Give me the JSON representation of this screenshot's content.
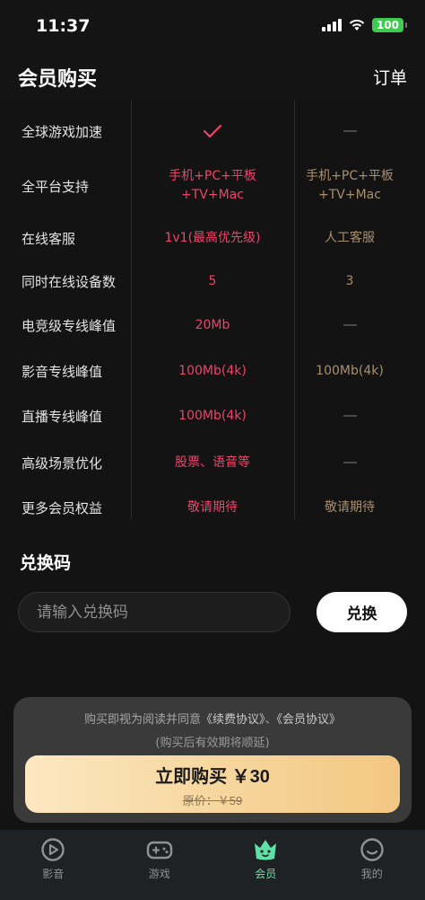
{
  "status": {
    "time": "11:37",
    "battery": "100"
  },
  "header": {
    "title": "会员购买",
    "orders": "订单"
  },
  "compare": {
    "rows": [
      {
        "name": "全球游戏加速",
        "vip": {
          "type": "check"
        },
        "std": {
          "type": "dash"
        }
      },
      {
        "name": "全平台支持",
        "vip": {
          "type": "text",
          "lines": [
            "手机+PC+平板",
            "+TV+Mac"
          ]
        },
        "std": {
          "type": "text",
          "lines": [
            "手机+PC+平板",
            "+TV+Mac"
          ]
        }
      },
      {
        "name": "在线客服",
        "vip": {
          "type": "text",
          "lines": [
            "1v1(最高优先级)"
          ]
        },
        "std": {
          "type": "text",
          "lines": [
            "人工客服"
          ]
        }
      },
      {
        "name": "同时在线设备数",
        "vip": {
          "type": "text",
          "lines": [
            "5"
          ]
        },
        "std": {
          "type": "text",
          "lines": [
            "3"
          ]
        }
      },
      {
        "name": "电竞级专线峰值",
        "vip": {
          "type": "text",
          "lines": [
            "20Mb"
          ]
        },
        "std": {
          "type": "dash"
        }
      },
      {
        "name": "影音专线峰值",
        "vip": {
          "type": "text",
          "lines": [
            "100Mb(4k)"
          ]
        },
        "std": {
          "type": "text",
          "lines": [
            "100Mb(4k)"
          ]
        }
      },
      {
        "name": "直播专线峰值",
        "vip": {
          "type": "text",
          "lines": [
            "100Mb(4k)"
          ]
        },
        "std": {
          "type": "dash"
        }
      },
      {
        "name": "高级场景优化",
        "vip": {
          "type": "text",
          "lines": [
            "股票、语音等"
          ]
        },
        "std": {
          "type": "dash"
        }
      },
      {
        "name": "更多会员权益",
        "vip": {
          "type": "text",
          "lines": [
            "敬请期待"
          ]
        },
        "std": {
          "type": "text",
          "lines": [
            "敬请期待"
          ]
        }
      }
    ]
  },
  "redeem": {
    "title": "兑换码",
    "placeholder": "请输入兑换码",
    "button": "兑换"
  },
  "purchase": {
    "agreement_prefix": "购买即视为阅读并同意",
    "agreement_renewal": "《续费协议》",
    "agreement_sep": "、",
    "agreement_member": "《会员协议》",
    "delay_note": "(购买后有效期将顺延)",
    "buy_label": "立即购买 ￥30",
    "original_price": "原价：￥59"
  },
  "tabs": [
    {
      "label": "影音",
      "icon": "play-circle-icon",
      "active": false
    },
    {
      "label": "游戏",
      "icon": "gamepad-icon",
      "active": false
    },
    {
      "label": "会员",
      "icon": "crown-face-icon",
      "active": true
    },
    {
      "label": "我的",
      "icon": "smile-face-icon",
      "active": false
    }
  ],
  "colors": {
    "vip_accent": "#f0436b",
    "std_text": "#a88f6f",
    "active_tab": "#6fe0a0"
  }
}
